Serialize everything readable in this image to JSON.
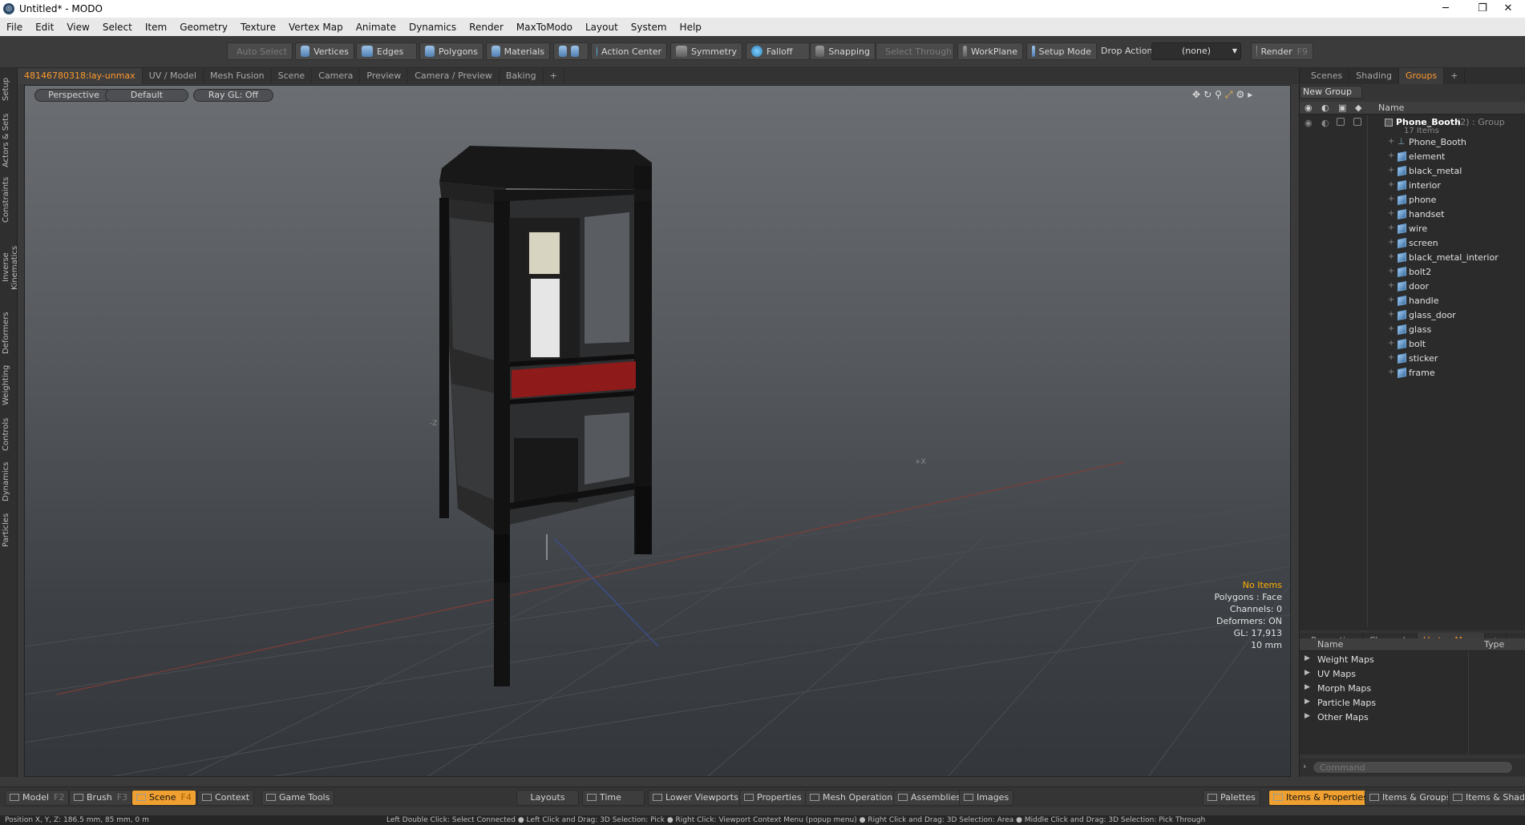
{
  "window": {
    "title": "Untitled* - MODO",
    "minimize": "─",
    "restore": "❐",
    "close": "✕"
  },
  "menubar": [
    "File",
    "Edit",
    "View",
    "Select",
    "Item",
    "Geometry",
    "Texture",
    "Vertex Map",
    "Animate",
    "Dynamics",
    "Render",
    "MaxToModo",
    "Layout",
    "System",
    "Help"
  ],
  "toolbar": {
    "auto_select": "Auto Select",
    "vertices": "Vertices",
    "edges": "Edges",
    "polygons": "Polygons",
    "materials": "Materials",
    "action_center": "Action Center",
    "symmetry": "Symmetry",
    "falloff": "Falloff",
    "snapping": "Snapping",
    "select_through": "Select Through",
    "workplane": "WorkPlane",
    "setup_mode": "Setup Mode",
    "drop_action_label": "Drop Action",
    "drop_action_value": "(none)",
    "render": "Render",
    "render_key": "F9"
  },
  "left_tabs": [
    "Setup",
    "Actors & Sets",
    "Constraints",
    "Inverse Kinematics",
    "Deformers",
    "Weighting",
    "Controls",
    "Dynamics",
    "Particles"
  ],
  "viewport_tabs": [
    "48146780318:lay-unmax",
    "UV / Model",
    "Mesh Fusion",
    "Scene",
    "Camera",
    "Preview",
    "Camera / Preview",
    "Baking",
    "+"
  ],
  "viewport": {
    "view_mode": "Perspective",
    "shading": "Default",
    "raygl": "Ray GL: Off",
    "info": {
      "no_items": "No Items",
      "polygons": "Polygons : Face",
      "channels": "Channels: 0",
      "deformers": "Deformers: ON",
      "gl": "GL: 17,913",
      "scale": "10 mm"
    }
  },
  "right_panel": {
    "top_tabs": [
      "Scenes",
      "Shading",
      "Groups",
      "+"
    ],
    "active_top_tab": "Groups",
    "new_group": "New Group",
    "col_name": "Name",
    "group": {
      "name": "Phone_Booth",
      "suffix": "(2) : Group",
      "count": "17 Items"
    },
    "items": [
      "Phone_Booth",
      "element",
      "black_metal",
      "interior",
      "phone",
      "handset",
      "wire",
      "screen",
      "black_metal_interior",
      "bolt2",
      "door",
      "handle",
      "glass_door",
      "glass",
      "bolt",
      "sticker",
      "frame"
    ],
    "bottom_tabs": [
      "Properties",
      "Channels",
      "Vertex Maps",
      "+"
    ],
    "active_bottom_tab": "Vertex Maps",
    "vmap_col_name": "Name",
    "vmap_col_type": "Type",
    "vertex_maps": [
      "Weight Maps",
      "UV Maps",
      "Morph Maps",
      "Particle Maps",
      "Other Maps"
    ],
    "command_placeholder": "Command"
  },
  "bottombar": {
    "model": "Model",
    "model_key": "F2",
    "brush": "Brush",
    "brush_key": "F3",
    "scene": "Scene",
    "scene_key": "F4",
    "context": "Context",
    "game_tools": "Game Tools",
    "layouts": "Layouts",
    "time": "Time",
    "lower_viewports": "Lower Viewports",
    "properties": "Properties",
    "mesh_operations": "Mesh Operations",
    "assemblies": "Assemblies",
    "images": "Images",
    "palettes": "Palettes",
    "items_properties": "Items & Properties",
    "items_groups": "Items & Groups",
    "items_shading": "Items & Shading"
  },
  "statusbar": {
    "position": "Position X, Y, Z:   186.5 mm, 85 mm, 0 m",
    "hints": "Left Double Click: Select Connected ● Left Click and Drag: 3D Selection: Pick ● Right Click: Viewport Context Menu (popup menu) ● Right Click and Drag: 3D Selection: Area ● Middle Click and Drag: 3D Selection: Pick Through"
  },
  "colors": {
    "accent": "#ff9a2c",
    "active_button": "#f0a030",
    "booth_red": "#8e1a1a"
  }
}
